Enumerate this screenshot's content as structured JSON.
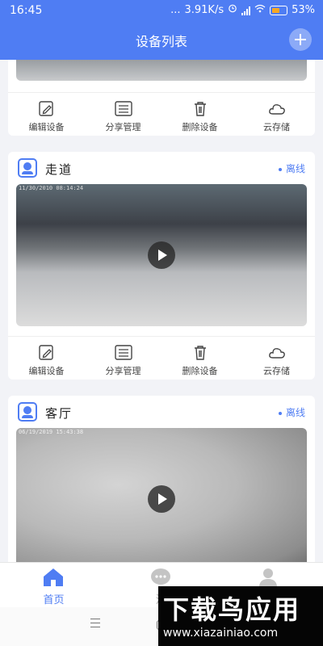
{
  "status_bar": {
    "time": "16:45",
    "dots": "...",
    "speed": "3.91K/s",
    "battery": "53%"
  },
  "header": {
    "title": "设备列表",
    "add_icon": "plus-circle-icon"
  },
  "colors": {
    "primary": "#4f7df3",
    "background": "#f2f3f7",
    "card": "#ffffff",
    "status": "#4f7df3",
    "battery": "#f6a623"
  },
  "action_labels": {
    "edit": "编辑设备",
    "share": "分享管理",
    "delete": "删除设备",
    "cloud": "云存储"
  },
  "devices": [
    {
      "name": "走道",
      "status": "离线",
      "timestamp": "11/30/2010 08:14:24"
    },
    {
      "name": "客厅",
      "status": "离线",
      "timestamp": "06/19/2019 15:43:38"
    }
  ],
  "bottom_nav": [
    {
      "label": "首页",
      "icon": "home-icon",
      "active": true
    },
    {
      "label": "消",
      "icon": "message-icon",
      "active": false
    },
    {
      "label": "",
      "icon": "user-icon",
      "active": false
    }
  ],
  "watermark": {
    "name": "下载鸟应用",
    "url": "www.xiazainiao.com"
  }
}
